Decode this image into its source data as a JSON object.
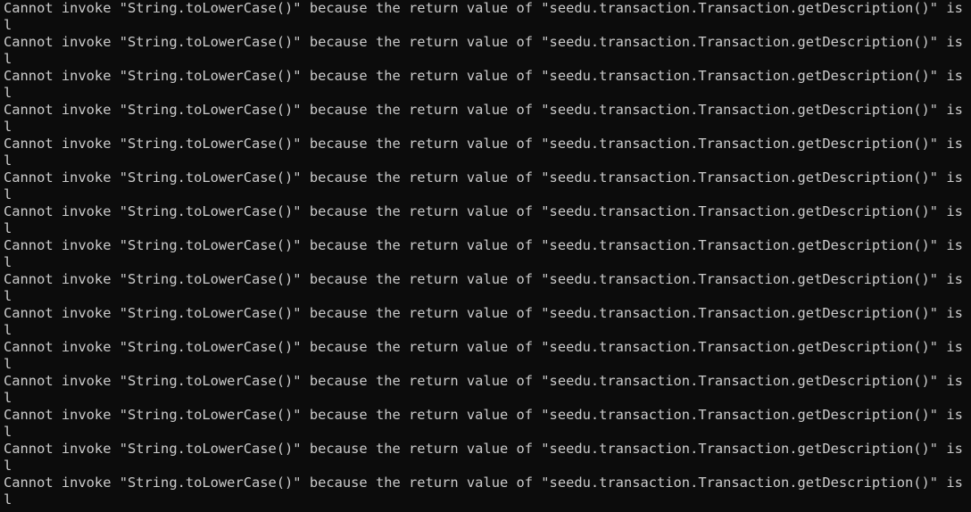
{
  "terminal": {
    "background": "#0c0c0c",
    "foreground": "#cccccc",
    "lines": [
      "Cannot invoke \"String.toLowerCase()\" because the return value of \"seedu.transaction.Transaction.getDescription()\" is nul",
      "l",
      "Cannot invoke \"String.toLowerCase()\" because the return value of \"seedu.transaction.Transaction.getDescription()\" is nul",
      "l",
      "Cannot invoke \"String.toLowerCase()\" because the return value of \"seedu.transaction.Transaction.getDescription()\" is nul",
      "l",
      "Cannot invoke \"String.toLowerCase()\" because the return value of \"seedu.transaction.Transaction.getDescription()\" is nul",
      "l",
      "Cannot invoke \"String.toLowerCase()\" because the return value of \"seedu.transaction.Transaction.getDescription()\" is nul",
      "l",
      "Cannot invoke \"String.toLowerCase()\" because the return value of \"seedu.transaction.Transaction.getDescription()\" is nul",
      "l",
      "Cannot invoke \"String.toLowerCase()\" because the return value of \"seedu.transaction.Transaction.getDescription()\" is nul",
      "l",
      "Cannot invoke \"String.toLowerCase()\" because the return value of \"seedu.transaction.Transaction.getDescription()\" is nul",
      "l",
      "Cannot invoke \"String.toLowerCase()\" because the return value of \"seedu.transaction.Transaction.getDescription()\" is nul",
      "l",
      "Cannot invoke \"String.toLowerCase()\" because the return value of \"seedu.transaction.Transaction.getDescription()\" is nul",
      "l",
      "Cannot invoke \"String.toLowerCase()\" because the return value of \"seedu.transaction.Transaction.getDescription()\" is nul",
      "l",
      "Cannot invoke \"String.toLowerCase()\" because the return value of \"seedu.transaction.Transaction.getDescription()\" is nul",
      "l",
      "Cannot invoke \"String.toLowerCase()\" because the return value of \"seedu.transaction.Transaction.getDescription()\" is nul",
      "l",
      "Cannot invoke \"String.toLowerCase()\" because the return value of \"seedu.transaction.Transaction.getDescription()\" is nul",
      "l",
      "Cannot invoke \"String.toLowerCase()\" because the return value of \"seedu.transaction.Transaction.getDescription()\" is nul",
      "l"
    ]
  }
}
